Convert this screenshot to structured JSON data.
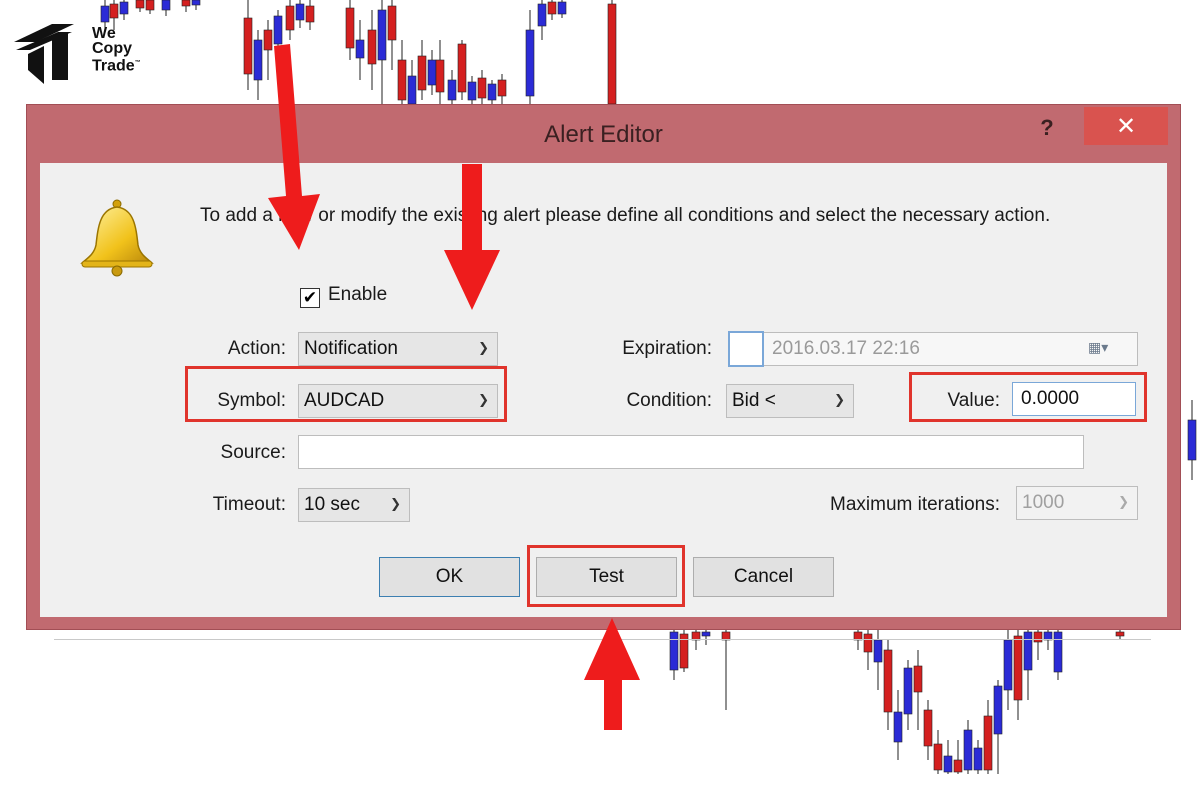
{
  "logo": {
    "line1": "We",
    "line2": "Copy",
    "line3": "Trade",
    "tm": "™"
  },
  "dialog": {
    "title": "Alert Editor",
    "help_label": "?",
    "close_label": "✕",
    "message": "To add a new or modify the existing alert please define all conditions and select the necessary action.",
    "enable": {
      "label": "Enable",
      "checked": true,
      "mark": "✔"
    },
    "action": {
      "label": "Action:",
      "value": "Notification"
    },
    "symbol": {
      "label": "Symbol:",
      "value": "AUDCAD"
    },
    "source": {
      "label": "Source:",
      "value": ""
    },
    "timeout": {
      "label": "Timeout:",
      "value": "10 sec"
    },
    "expiration": {
      "label": "Expiration:",
      "value": "2016.03.17 22:16"
    },
    "condition": {
      "label": "Condition:",
      "value": "Bid <"
    },
    "value": {
      "label": "Value:",
      "value": "0.0000"
    },
    "max_iterations": {
      "label": "Maximum iterations:",
      "value": "1000"
    },
    "buttons": {
      "ok": "OK",
      "test": "Test",
      "cancel": "Cancel"
    }
  },
  "icons": {
    "bell": "bell-icon",
    "dropdown": "chevron-down-icon",
    "calendar": "calendar-icon"
  },
  "colors": {
    "frame": "#c16a70",
    "highlight": "#e0342c",
    "arrow": "#ee1c1c",
    "bull_candle": "#2b2bd6",
    "bear_candle": "#d42020"
  }
}
